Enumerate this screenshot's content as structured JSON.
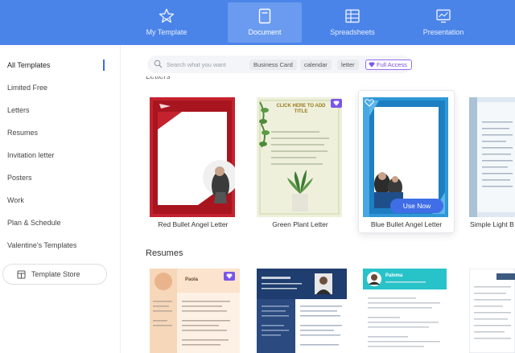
{
  "topnav": {
    "tabs": [
      {
        "label": "My Template",
        "icon": "star-icon"
      },
      {
        "label": "Document",
        "icon": "document-icon",
        "active": true
      },
      {
        "label": "Spreadsheets",
        "icon": "spreadsheet-icon"
      },
      {
        "label": "Presentation",
        "icon": "presentation-icon"
      }
    ]
  },
  "sidebar": {
    "items": [
      "All Templates",
      "Limited Free",
      "Letters",
      "Resumes",
      "Invitation letter",
      "Posters",
      "Work",
      "Plan & Schedule",
      "Valentine's Templates"
    ],
    "active_index": 0,
    "store_button": "Template Store"
  },
  "search": {
    "placeholder": "Search what you want",
    "chips": [
      "Business Card",
      "calendar",
      "letter"
    ],
    "full_access": "Full Access"
  },
  "sections": {
    "letters": "Letters",
    "resumes": "Resumes"
  },
  "cards": [
    {
      "title": "Red Bullet Angel Letter"
    },
    {
      "title": "Green Plant Letter",
      "inner_text": "CLICK HERE TO ADD TITLE"
    },
    {
      "title": "Blue Bullet Angel Letter",
      "button": "Use Now"
    },
    {
      "title": "Simple Light B"
    }
  ],
  "resume_cards": {
    "first_name": "Paola",
    "third_name": "Paloma"
  },
  "colors": {
    "topbar": "#4b84e8",
    "accent": "#3f6ee6",
    "premium": "#7b55e9"
  }
}
